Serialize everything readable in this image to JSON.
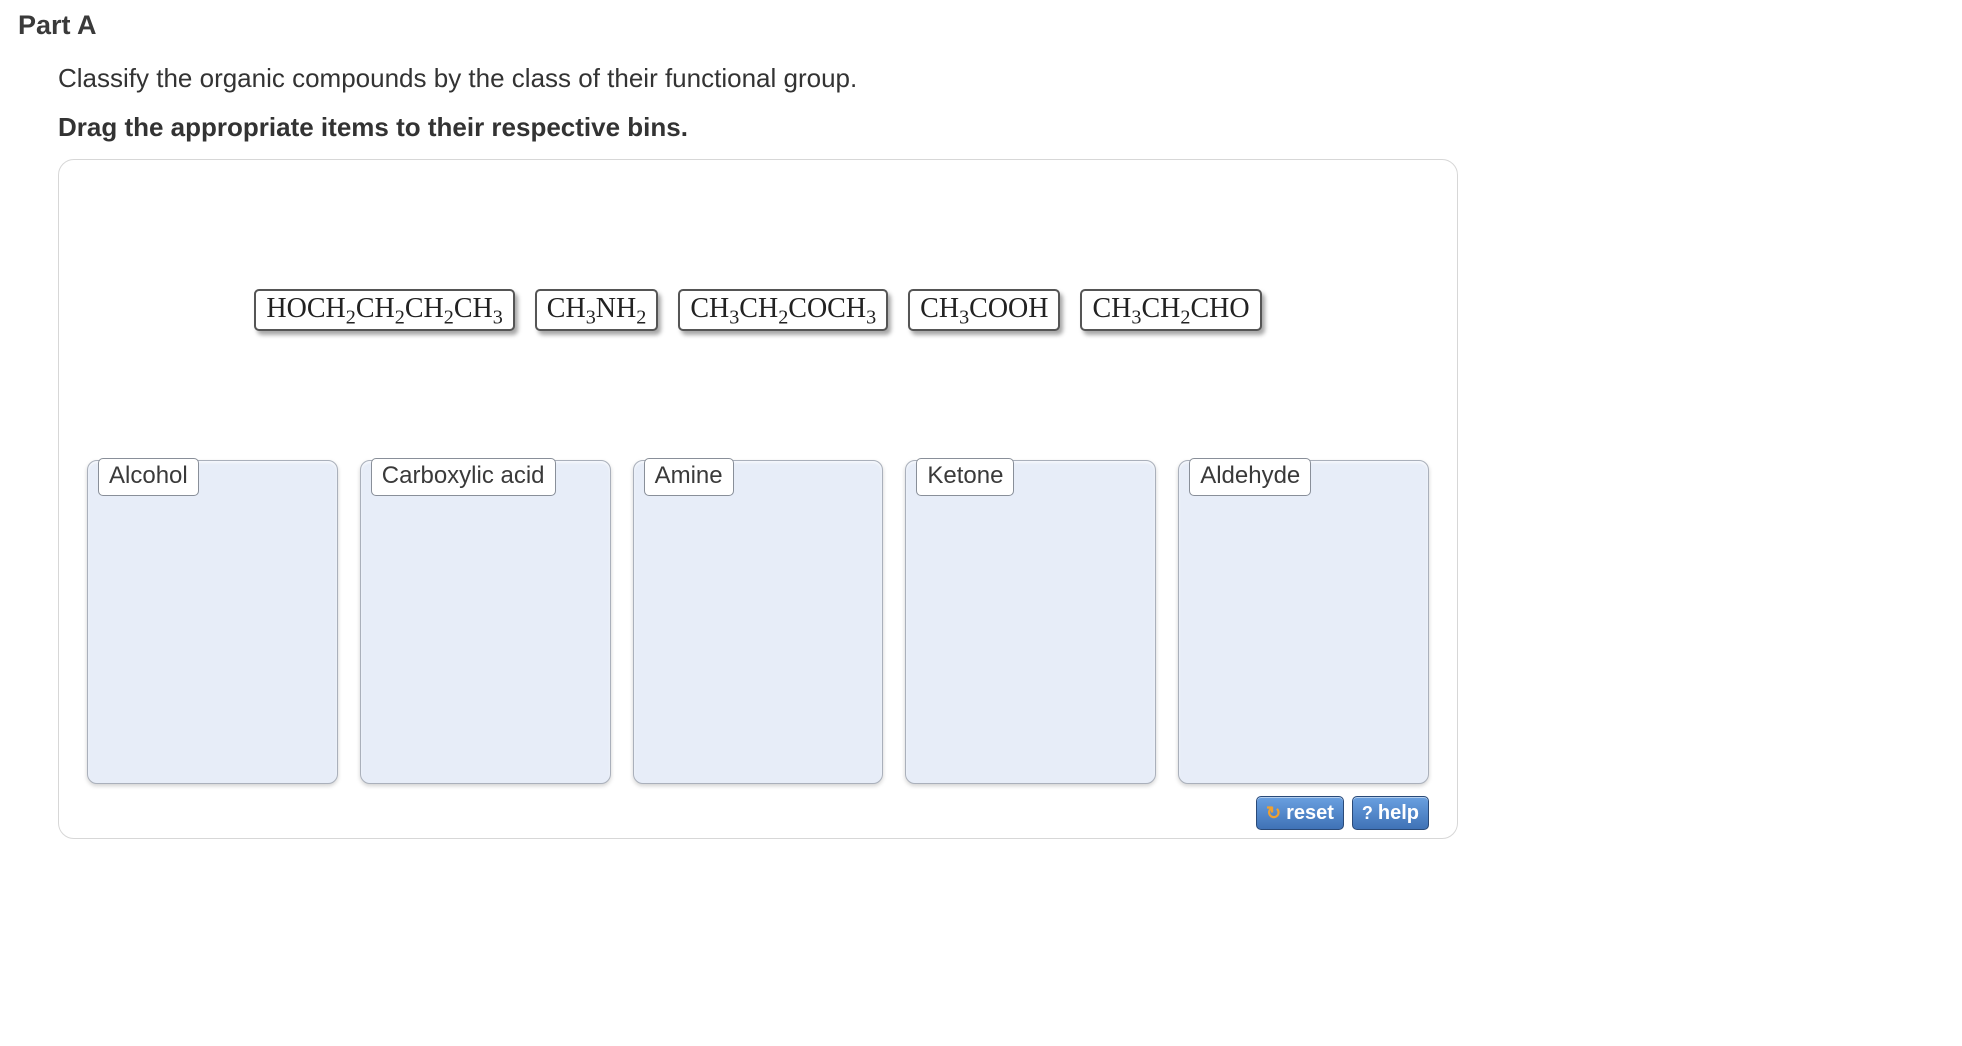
{
  "part_label": "Part A",
  "question": "Classify the organic compounds by the class of their functional group.",
  "drag_instructions": "Drag the appropriate items to their respective bins.",
  "items": [
    {
      "formula_html": "HOCH<sub>2</sub>CH<sub>2</sub>CH<sub>2</sub>CH<sub>3</sub>"
    },
    {
      "formula_html": "CH<sub>3</sub>NH<sub>2</sub>"
    },
    {
      "formula_html": "CH<sub>3</sub>CH<sub>2</sub>COCH<sub>3</sub>"
    },
    {
      "formula_html": "CH<sub>3</sub>COOH"
    },
    {
      "formula_html": "CH<sub>3</sub>CH<sub>2</sub>CHO"
    }
  ],
  "bins": [
    {
      "label": "Alcohol"
    },
    {
      "label": "Carboxylic acid"
    },
    {
      "label": "Amine"
    },
    {
      "label": "Ketone"
    },
    {
      "label": "Aldehyde"
    }
  ],
  "controls": {
    "reset_label": "reset",
    "help_label": "help"
  }
}
